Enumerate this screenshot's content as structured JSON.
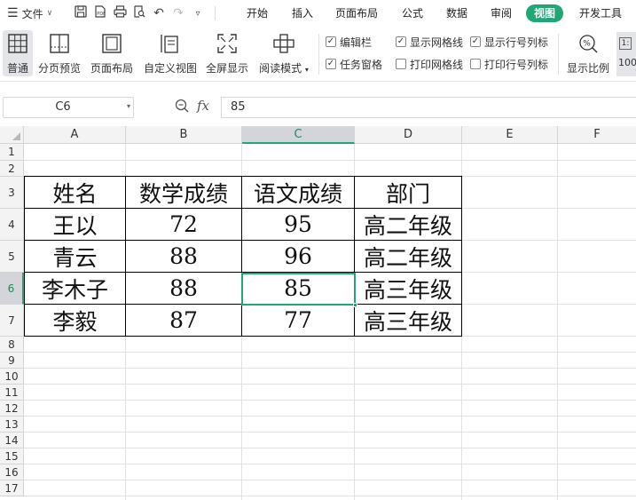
{
  "menu": {
    "file_label": "文件",
    "tabs": [
      {
        "label": "开始"
      },
      {
        "label": "插入"
      },
      {
        "label": "页面布局"
      },
      {
        "label": "公式"
      },
      {
        "label": "数据"
      },
      {
        "label": "审阅"
      },
      {
        "label": "视图",
        "active": true
      },
      {
        "label": "开发工具"
      }
    ]
  },
  "ribbon": {
    "buttons": [
      {
        "label": "普通",
        "icon": "grid-view-icon",
        "selected": true
      },
      {
        "label": "分页预览",
        "icon": "page-break-preview-icon"
      },
      {
        "label": "页面布局",
        "icon": "page-layout-icon"
      },
      {
        "label": "自定义视图",
        "icon": "custom-view-icon"
      },
      {
        "label": "全屏显示",
        "icon": "fullscreen-icon"
      },
      {
        "label": "阅读模式",
        "icon": "reading-mode-icon"
      }
    ],
    "checkboxes": [
      {
        "label": "编辑栏",
        "checked": true
      },
      {
        "label": "显示网格线",
        "checked": true
      },
      {
        "label": "显示行号列标",
        "checked": true
      },
      {
        "label": "任务窗格",
        "checked": true
      },
      {
        "label": "打印网格线",
        "checked": false
      },
      {
        "label": "打印行号列标",
        "checked": false
      }
    ],
    "zoom_ratio_label": "显示比例",
    "zoom_100_label": "100"
  },
  "formula_bar": {
    "name_box": "C6",
    "fx_label": "fx",
    "value": "85"
  },
  "sheet": {
    "columns": [
      "A",
      "B",
      "C",
      "D",
      "E",
      "F"
    ],
    "rows": [
      "1",
      "2",
      "3",
      "4",
      "5",
      "6",
      "7",
      "8",
      "9",
      "10",
      "11",
      "12",
      "13",
      "14",
      "15",
      "16",
      "17"
    ],
    "selected_column": "C",
    "selected_row": "6",
    "table": {
      "header": [
        "姓名",
        "数学成绩",
        "语文成绩",
        "部门"
      ],
      "rows": [
        [
          "王以",
          "72",
          "95",
          "高二年级"
        ],
        [
          "青云",
          "88",
          "96",
          "高二年级"
        ],
        [
          "李木子",
          "88",
          "85",
          "高三年级"
        ],
        [
          "李毅",
          "87",
          "77",
          "高三年级"
        ]
      ]
    }
  },
  "colors": {
    "accent": "#1fa774",
    "header_bg": "#f3f3f3",
    "selected_header_bg": "#d3d5db"
  }
}
